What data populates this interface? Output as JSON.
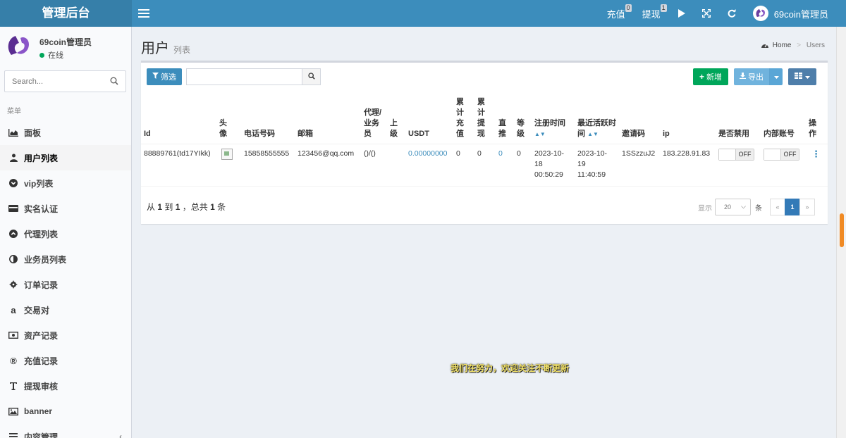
{
  "header": {
    "brand": "管理后台",
    "recharge_label": "充值",
    "recharge_badge": "0",
    "withdraw_label": "提现",
    "withdraw_badge": "1",
    "user_name": "69coin管理员",
    "brand_color": "#3c8dbc",
    "icons": [
      "menu-toggle-icon",
      "play-icon",
      "fullscreen-icon",
      "refresh-icon"
    ]
  },
  "sidebar": {
    "user_name": "69coin管理员",
    "user_status": "在线",
    "search_placeholder": "Search...",
    "menu_header": "菜单",
    "items": [
      {
        "label": "面板",
        "icon": "chart-icon"
      },
      {
        "label": "用户列表",
        "icon": "user-icon",
        "active": true
      },
      {
        "label": "vip列表",
        "icon": "chevron-circle-icon"
      },
      {
        "label": "实名认证",
        "icon": "id-card-icon"
      },
      {
        "label": "代理列表",
        "icon": "chevron-up-circle-icon"
      },
      {
        "label": "业务员列表",
        "icon": "half-circle-icon"
      },
      {
        "label": "订单记录",
        "icon": "gear-icon"
      },
      {
        "label": "交易对",
        "icon": "amazon-icon"
      },
      {
        "label": "资产记录",
        "icon": "money-icon"
      },
      {
        "label": "充值记录",
        "icon": "registered-icon"
      },
      {
        "label": "提现审核",
        "icon": "text-height-icon"
      },
      {
        "label": "banner",
        "icon": "image-icon"
      },
      {
        "label": "内容管理",
        "icon": "list-icon"
      }
    ]
  },
  "page": {
    "title": "用户",
    "subtitle": "列表",
    "breadcrumb": {
      "home": "Home",
      "current": "Users"
    }
  },
  "toolbar": {
    "filter_label": "筛选",
    "new_label": "新增",
    "export_label": "导出"
  },
  "table": {
    "columns": [
      "Id",
      "头像",
      "电话号码",
      "邮箱",
      "代理/业务员",
      "上级",
      "USDT",
      "累计充值",
      "累计提现",
      "直推",
      "等级",
      "注册时间",
      "最近活跃时间",
      "邀请码",
      "ip",
      "是否禁用",
      "内部账号",
      "操作"
    ],
    "rows": [
      {
        "id": "88889761(td17YIkk)",
        "phone": "15858555555",
        "email": "123456@qq.com",
        "agent": "()/()",
        "parent": "",
        "usdt": "0.00000000",
        "total_recharge": "0",
        "total_withdraw": "0",
        "direct": "0",
        "level": "0",
        "reg_time": "2023-10-18 00:50:29",
        "active_time": "2023-10-19 11:40:59",
        "invite_code": "1SSzzuJ2",
        "ip": "183.228.91.83",
        "disabled": "OFF",
        "internal": "OFF"
      }
    ]
  },
  "footer": {
    "summary_prefix": "从",
    "summary_from": "1",
    "summary_to_word": "到",
    "summary_to": "1",
    "summary_total_word": "，总共",
    "summary_total": "1",
    "summary_unit": "条",
    "show_label": "显示",
    "page_size": "20",
    "page_unit": "条",
    "pages": [
      "«",
      "1",
      "»"
    ],
    "current_page": "1"
  },
  "center_note": "我们在努力，欢迎关注不断更新"
}
